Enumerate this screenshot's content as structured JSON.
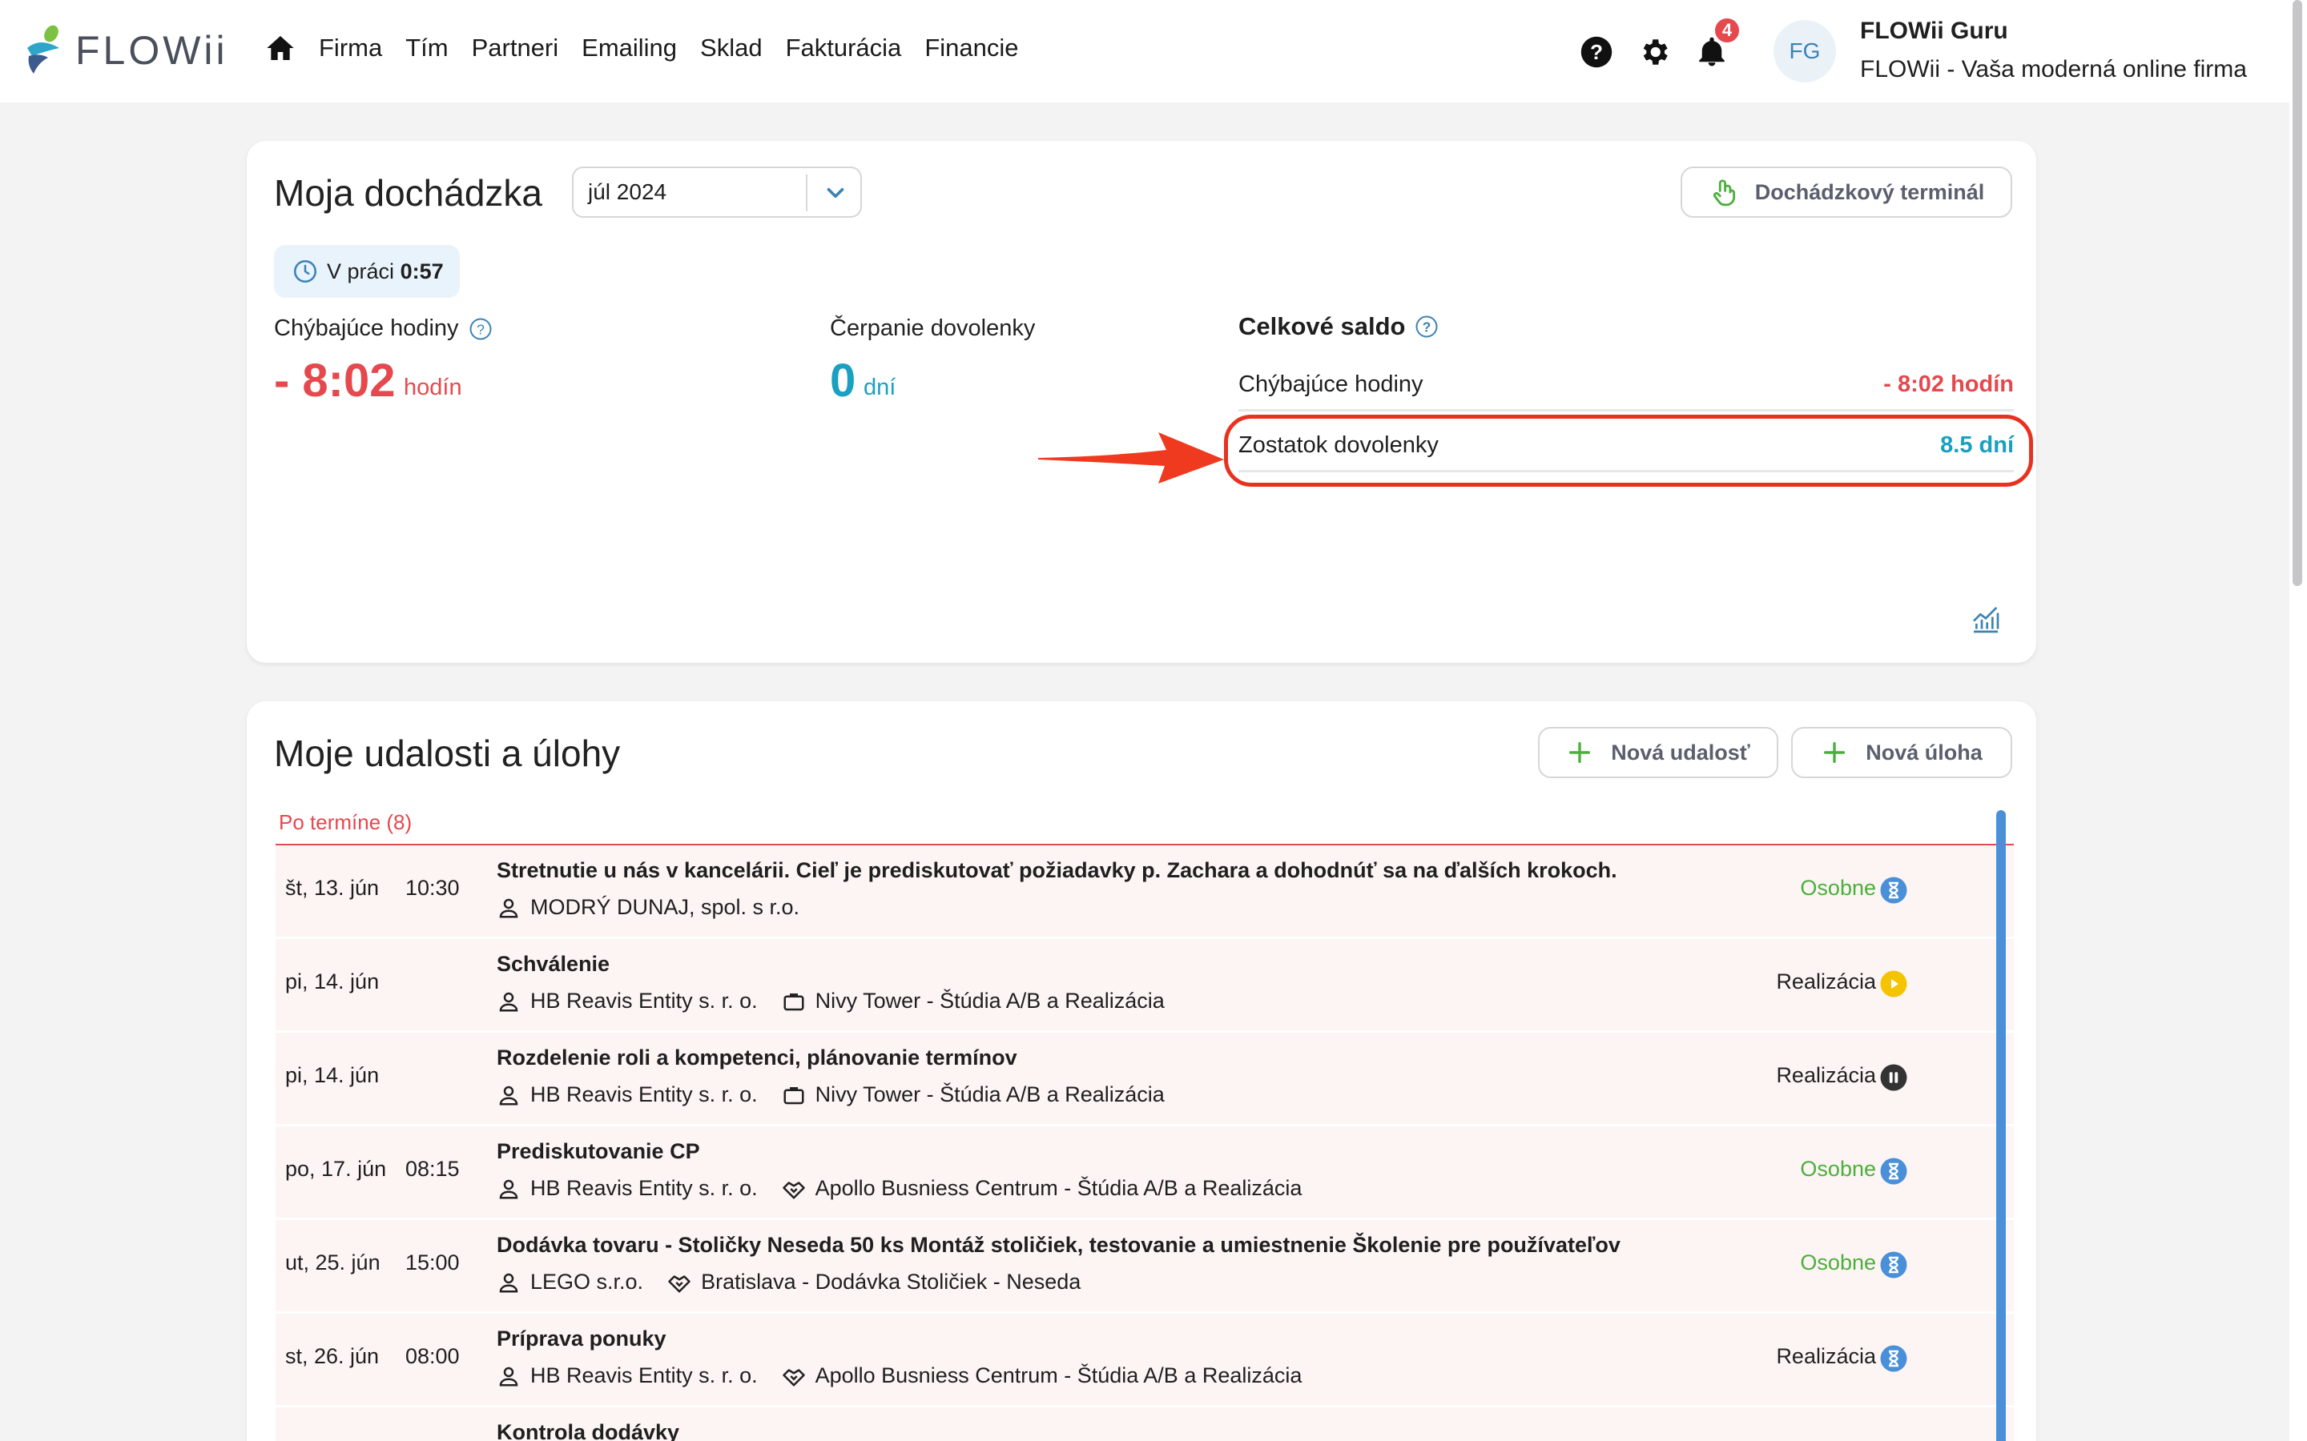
{
  "app": {
    "brand": "FLOWii"
  },
  "nav": {
    "items": [
      "Firma",
      "Tím",
      "Partneri",
      "Emailing",
      "Sklad",
      "Fakturácia",
      "Financie"
    ]
  },
  "header": {
    "notifications_count": "4",
    "avatar_initials": "FG",
    "user_name": "FLOWii Guru",
    "user_subtitle": "FLOWii - Vaša moderná online firma"
  },
  "attendance": {
    "title": "Moja dochádzka",
    "month": "júl 2024",
    "terminal_button": "Dochádzkový terminál",
    "at_work_label": "V práci",
    "at_work_value": "0:57",
    "missing_label": "Chýbajúce hodiny",
    "missing_value": "- 8:02",
    "missing_unit": "hodín",
    "vacation_label": "Čerpanie dovolenky",
    "vacation_value": "0",
    "vacation_unit": "dní",
    "saldo_title": "Celkové saldo",
    "saldo_missing_label": "Chýbajúce hodiny",
    "saldo_missing_value": "- 8:02 hodín",
    "saldo_vacation_label": "Zostatok dovolenky",
    "saldo_vacation_value": "8.5 dní"
  },
  "events": {
    "title": "Moje udalosti a úlohy",
    "new_event": "Nová udalosť",
    "new_task": "Nová úloha",
    "overdue_label": "Po termíne (8)",
    "rows": [
      {
        "date": "št, 13. jún",
        "time": "10:30",
        "title": "Stretnutie u nás v kancelárii. Cieľ je prediskutovať požiadavky p. Zachara a dohodnúť sa na ďalších krokoch.",
        "partner": "MODRÝ DUNAJ, spol. s r.o.",
        "project": "",
        "category": "Osobne",
        "status": "hourglass"
      },
      {
        "date": "pi, 14. jún",
        "time": "",
        "title": "Schválenie",
        "partner": "HB Reavis Entity s. r. o.",
        "project": "Nivy Tower - Štúdia A/B a Realizácia",
        "category": "Realizácia",
        "status": "play"
      },
      {
        "date": "pi, 14. jún",
        "time": "",
        "title": "Rozdelenie roli a kompetenci, plánovanie termínov",
        "partner": "HB Reavis Entity s. r. o.",
        "project": "Nivy Tower - Štúdia A/B a Realizácia",
        "category": "Realizácia",
        "status": "pause"
      },
      {
        "date": "po, 17. jún",
        "time": "08:15",
        "title": "Prediskutovanie CP",
        "partner": "HB Reavis Entity s. r. o.",
        "project": "Apollo Busniess Centrum - Štúdia A/B a Realizácia",
        "category": "Osobne",
        "status": "hourglass"
      },
      {
        "date": "ut, 25. jún",
        "time": "15:00",
        "title": "Dodávka tovaru - Stoličky Neseda 50 ks Montáž stoličiek, testovanie a umiestnenie Školenie pre používateľov",
        "partner": "LEGO s.r.o.",
        "project": "Bratislava - Dodávka Stoličiek - Neseda",
        "category": "Osobne",
        "status": "hourglass"
      },
      {
        "date": "st, 26. jún",
        "time": "08:00",
        "title": "Príprava ponuky",
        "partner": "HB Reavis Entity s. r. o.",
        "project": "Apollo Busniess Centrum - Štúdia A/B a Realizácia",
        "category": "Realizácia",
        "status": "hourglass"
      },
      {
        "date": "",
        "time": "",
        "title": "Kontrola dodávky",
        "partner": "",
        "project": "",
        "category": "",
        "status": ""
      }
    ]
  }
}
